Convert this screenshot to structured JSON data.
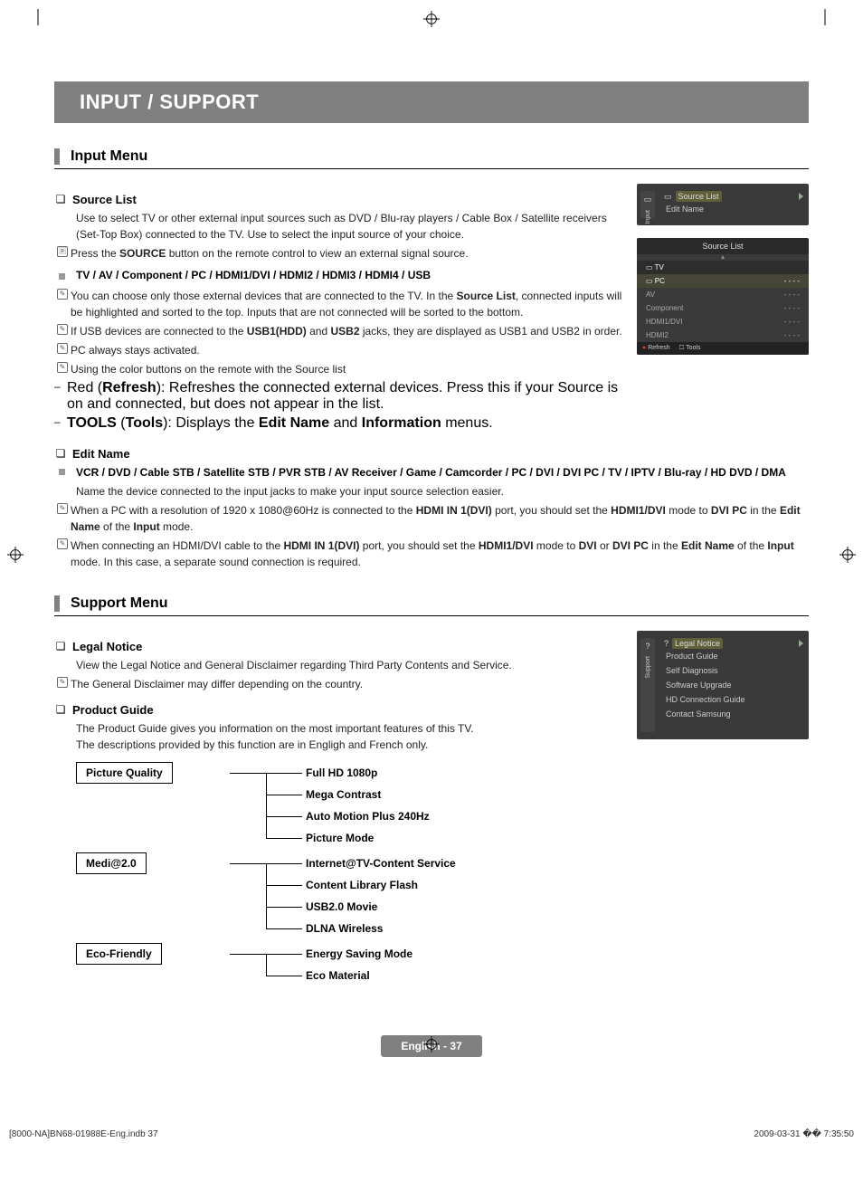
{
  "registration_label": "⊕",
  "title": "INPUT / SUPPORT",
  "section_input_menu": "Input Menu",
  "source_list": {
    "heading": "Source List",
    "body": "Use to select TV or other external input sources such as DVD / Blu-ray players / Cable Box / Satellite receivers (Set-Top Box) connected to the TV. Use to select the input source of your choice.",
    "press_prefix": "Press the ",
    "press_bold": "SOURCE",
    "press_suffix": " button on the remote control to view an external signal source."
  },
  "devices_heading": "TV / AV / Component / PC / HDMI1/DVI / HDMI2 / HDMI3 / HDMI4 / USB",
  "devices_note1_a": "You can choose only those external devices that are connected to the TV. In the ",
  "devices_note1_b": "Source List",
  "devices_note1_c": ", connected inputs will be highlighted and sorted to the top. Inputs that are not connected will be sorted to the bottom.",
  "devices_note2_a": "If USB devices are connected to the ",
  "devices_note2_b": "USB1(HDD)",
  "devices_note2_c": " and ",
  "devices_note2_d": "USB2",
  "devices_note2_e": " jacks, they are displayed as USB1 and USB2 in order.",
  "devices_note3": "PC always stays activated.",
  "devices_note4": "Using the color buttons on the remote with the Source list",
  "devices_dash1_a": "Red (",
  "devices_dash1_b": "Refresh",
  "devices_dash1_c": "): Refreshes the connected external devices. Press this if your Source is on and connected, but does not appear in the list.",
  "devices_dash2_a": "TOOLS",
  "devices_dash2_b": " (",
  "devices_dash2_c": "Tools",
  "devices_dash2_d": "): Displays the ",
  "devices_dash2_e": "Edit Name",
  "devices_dash2_f": " and ",
  "devices_dash2_g": "Information",
  "devices_dash2_h": " menus.",
  "edit_name": {
    "heading": "Edit Name",
    "sub": "VCR / DVD / Cable STB / Satellite STB / PVR STB / AV Receiver / Game / Camcorder / PC / DVI / DVI PC / TV / IPTV / Blu-ray / HD DVD / DMA",
    "body": "Name the device connected to the input jacks to make your input source selection easier.",
    "n1_a": "When a PC with a resolution of 1920 x 1080@60Hz is connected to the ",
    "n1_b": "HDMI IN 1(DVI)",
    "n1_c": " port, you should set the ",
    "n1_d": "HDMI1/DVI",
    "n1_e": " mode to ",
    "n1_f": "DVI PC",
    "n1_g": " in the ",
    "n1_h": "Edit Name",
    "n1_i": " of the ",
    "n1_j": "Input",
    "n1_k": " mode.",
    "n2_a": "When connecting an HDMI/DVI cable to the ",
    "n2_b": "HDMI IN 1(DVI)",
    "n2_c": " port, you should set the ",
    "n2_d": "HDMI1/DVI",
    "n2_e": " mode to ",
    "n2_f": "DVI",
    "n2_g": " or ",
    "n2_h": "DVI PC",
    "n2_i": " in the ",
    "n2_j": "Edit Name",
    "n2_k": " of the ",
    "n2_l": "Input",
    "n2_m": " mode. In this case, a separate sound connection is required."
  },
  "section_support_menu": "Support Menu",
  "legal_notice": {
    "heading": "Legal Notice",
    "body": "View the Legal Notice and General Disclaimer regarding Third Party Contents and Service.",
    "note": "The General Disclaimer may differ depending on the country."
  },
  "product_guide": {
    "heading": "Product Guide",
    "body1": "The Product Guide gives you information on the most important features of this TV.",
    "body2": "The descriptions provided by this function are in Engligh and French only."
  },
  "tree": {
    "groups": [
      {
        "label": "Picture Quality",
        "items": [
          "Full HD 1080p",
          "Mega Contrast",
          "Auto Motion Plus 240Hz",
          "Picture Mode"
        ]
      },
      {
        "label": "Medi@2.0",
        "items": [
          "Internet@TV-Content Service",
          "Content Library Flash",
          "USB2.0 Movie",
          "DLNA Wireless"
        ]
      },
      {
        "label": "Eco-Friendly",
        "items": [
          "Energy Saving Mode",
          "Eco Material"
        ]
      }
    ]
  },
  "osd1": {
    "side_label": "Input",
    "line1": "Source List",
    "line2": "Edit Name"
  },
  "osd2": {
    "title": "Source List",
    "rows": [
      {
        "label": "TV",
        "val": ""
      },
      {
        "label": "PC",
        "val": "- - - -"
      },
      {
        "label": "AV",
        "val": "- - - -"
      },
      {
        "label": "Component",
        "val": "- - - -"
      },
      {
        "label": "HDMI1/DVI",
        "val": "- - - -"
      },
      {
        "label": "HDMI2",
        "val": "- - - -"
      }
    ],
    "footer_refresh": "Refresh",
    "footer_tools": "Tools"
  },
  "osd3": {
    "side_label": "Support",
    "highlight": "Legal Notice",
    "items": [
      "Product Guide",
      "Self Diagnosis",
      "Software Upgrade",
      "HD Connection Guide",
      "Contact Samsung"
    ]
  },
  "footer_page": "English - 37",
  "bottom_left": "[8000-NA]BN68-01988E-Eng.indb   37",
  "bottom_right": "2009-03-31   �� 7:35:50"
}
